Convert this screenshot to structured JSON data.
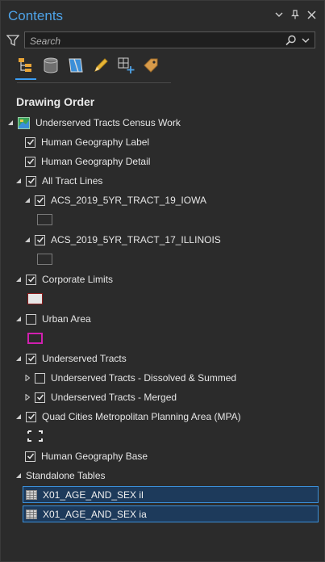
{
  "header": {
    "title": "Contents"
  },
  "search": {
    "placeholder": "Search"
  },
  "section": {
    "title": "Drawing Order"
  },
  "tree": {
    "map": "Underserved Tracts Census Work",
    "hg_label": "Human Geography Label",
    "hg_detail": "Human Geography Detail",
    "tract_lines": "All Tract Lines",
    "iowa": "ACS_2019_5YR_TRACT_19_IOWA",
    "illinois": "ACS_2019_5YR_TRACT_17_ILLINOIS",
    "corporate": "Corporate Limits",
    "urban": "Urban Area",
    "underserved": "Underserved Tracts",
    "dissolved": "Underserved Tracts - Dissolved & Summed",
    "merged": "Underserved Tracts - Merged",
    "mpa": "Quad Cities Metropolitan Planning Area (MPA)",
    "hg_base": "Human Geography Base",
    "standalone": "Standalone Tables"
  },
  "tables": [
    "X01_AGE_AND_SEX il",
    "X01_AGE_AND_SEX ia"
  ],
  "colors": {
    "accent": "#4ea3e8",
    "selection": "#1d3a5b",
    "urban_outline": "#d11fb0",
    "corporate_outline": "#8a1c1c"
  }
}
